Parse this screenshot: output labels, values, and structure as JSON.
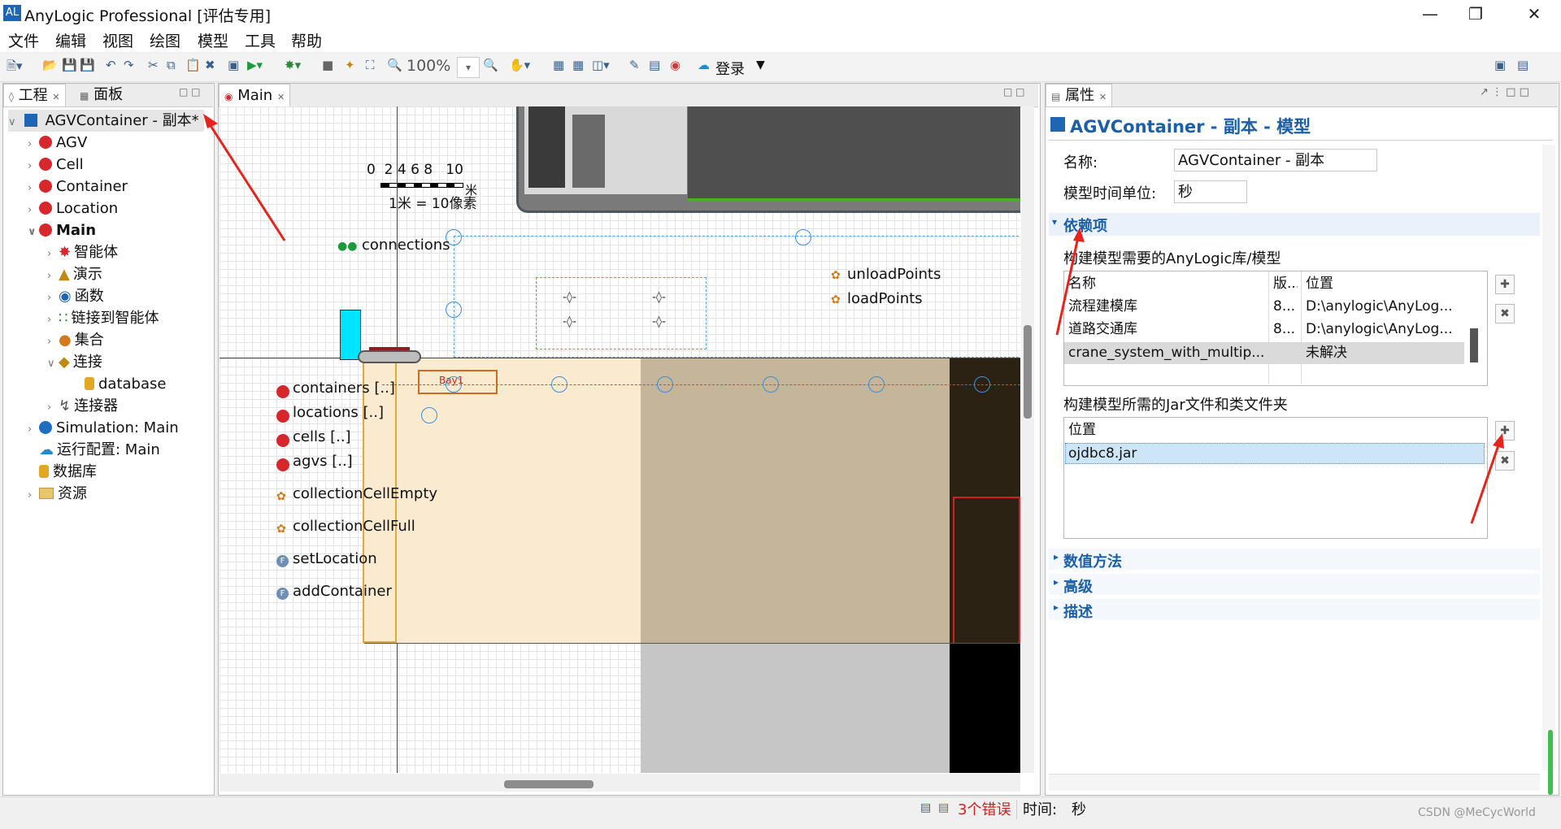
{
  "window": {
    "title": "AnyLogic Professional [评估专用]"
  },
  "menu": [
    "文件",
    "编辑",
    "视图",
    "绘图",
    "模型",
    "工具",
    "帮助"
  ],
  "toolbar": {
    "zoom": "100%",
    "login": "登录"
  },
  "left_panel": {
    "tabs": [
      "工程",
      "面板"
    ],
    "tree": {
      "root": "AGVContainer - 副本*",
      "items": [
        "AGV",
        "Cell",
        "Container",
        "Location",
        "Main"
      ],
      "main_children": [
        "智能体",
        "演示",
        "函数",
        "链接到智能体",
        "集合",
        "连接"
      ],
      "connection_child": "database",
      "after_connection": "连接器",
      "bottom_items": [
        "Simulation: Main",
        "运行配置: Main",
        "数据库",
        "资源"
      ]
    }
  },
  "editor": {
    "tab": "Main",
    "scale_ticks": "0  2 4 6 8   10",
    "scale_unit": "米",
    "scale_caption": "1米 = 10像素",
    "labels": {
      "connections": "connections",
      "unloadPoints": "unloadPoints",
      "loadPoints": "loadPoints",
      "bay": "Bay1",
      "containers": "containers [..]",
      "locations": "locations [..]",
      "cells": "cells [..]",
      "agvs": "agvs [..]",
      "collectionCellEmpty": "collectionCellEmpty",
      "collectionCellFull": "collectionCellFull",
      "setLocation": "setLocation",
      "addContainer": "addContainer"
    }
  },
  "properties": {
    "tab": "属性",
    "heading": "AGVContainer - 副本 - 模型",
    "name_label": "名称:",
    "name_value": "AGVContainer - 副本",
    "time_unit_label": "模型时间单位:",
    "time_unit_value": "秒",
    "sections": {
      "deps": "依赖项",
      "numeric": "数值方法",
      "advanced": "高级",
      "desc": "描述"
    },
    "lib_caption": "构建模型需要的AnyLogic库/模型",
    "lib_headers": [
      "名称",
      "版...",
      "位置"
    ],
    "lib_rows": [
      [
        "流程建模库",
        "8...",
        "D:\\anylogic\\AnyLog..."
      ],
      [
        "道路交通库",
        "8...",
        "D:\\anylogic\\AnyLog..."
      ],
      [
        "crane_system_with_multip...",
        "",
        "未解决"
      ]
    ],
    "jar_caption": "构建模型所需的Jar文件和类文件夹",
    "jar_header": "位置",
    "jar_rows": [
      "ojdbc8.jar"
    ]
  },
  "status": {
    "errors": "3个错误",
    "time_label": "时间:",
    "time_value": "秒"
  },
  "watermark": "CSDN @MeCycWorld",
  "colors": {
    "accent": "#1a5fa8",
    "annotation_arrow": "#e8231b",
    "zone_light": "#faebd0",
    "zone_tan": "#c4b59b",
    "dark": "#2b2214"
  }
}
